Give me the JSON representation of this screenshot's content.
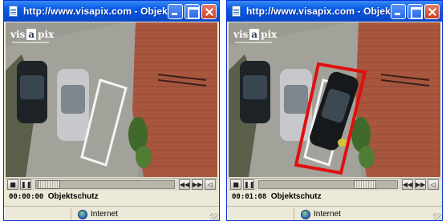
{
  "colors": {
    "titlebar_blue": "#0a5ee8",
    "highlight_red": "#e01010",
    "zone_outline": "#ffffff"
  },
  "windows": [
    {
      "title": "http://www.visapix.com - Objekts...",
      "logo": {
        "text_a": "vis",
        "text_box": "a",
        "text_b": "pix"
      },
      "timecode": "00:00:00",
      "caption": "Objektschutz",
      "status_zone": "Internet",
      "detection_highlight": false
    },
    {
      "title": "http://www.visapix.com - Objekts...",
      "logo": {
        "text_a": "vis",
        "text_box": "a",
        "text_b": "pix"
      },
      "timecode": "00:01:08",
      "caption": "Objektschutz",
      "status_zone": "Internet",
      "detection_highlight": true
    }
  ],
  "controls": {
    "stop_icon": "stop-icon",
    "pause_icon": "pause-icon",
    "rewind_icon": "rewind-icon",
    "forward_icon": "fast-forward-icon",
    "volume_icon": "volume-icon"
  }
}
